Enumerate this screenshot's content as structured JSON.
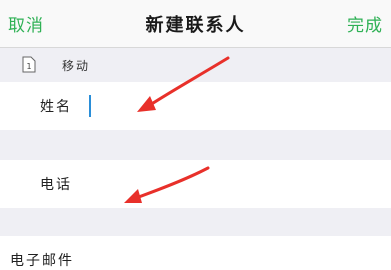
{
  "navbar": {
    "cancel_label": "取消",
    "title": "新建联系人",
    "done_label": "完成"
  },
  "sim": {
    "label": "移动",
    "icon": "sim-card-icon",
    "number": "1"
  },
  "fields": {
    "name_label": "姓名",
    "name_value": "",
    "phone_label": "电话",
    "phone_value": "",
    "email_label": "电子邮件"
  },
  "colors": {
    "accent": "#2fb155",
    "cursor": "#2a8ed8",
    "annotation": "#e8302a",
    "group_background": "#efeff4"
  }
}
